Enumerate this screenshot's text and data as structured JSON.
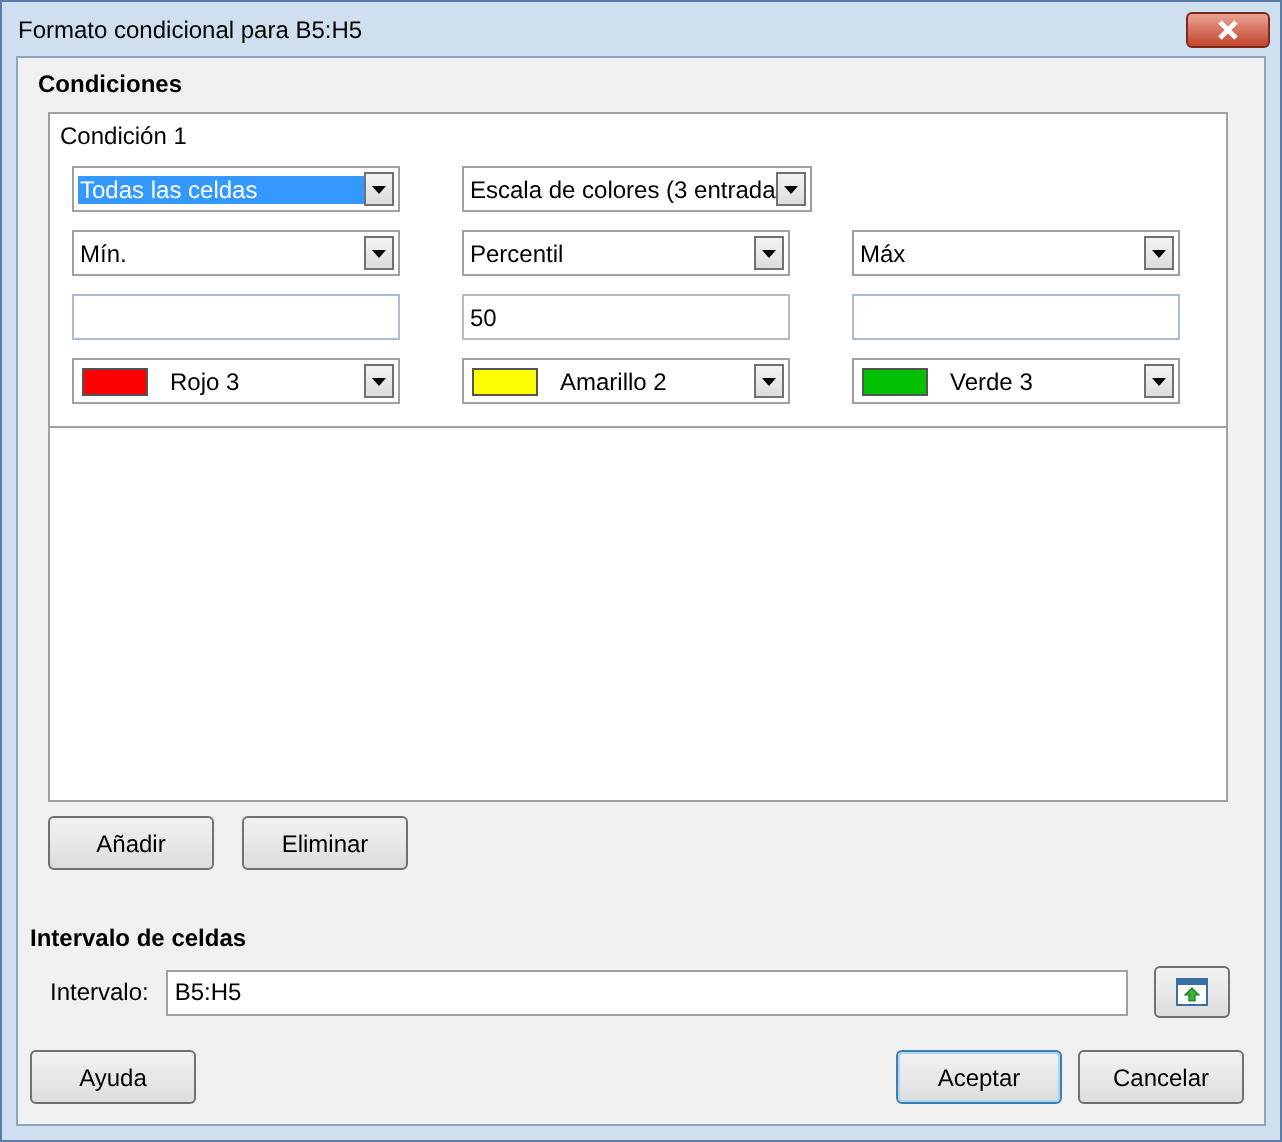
{
  "window": {
    "title": "Formato condicional para B5:H5"
  },
  "conditions": {
    "heading": "Condiciones",
    "items": [
      {
        "title": "Condición 1",
        "rows": [
          [
            {
              "kind": "dropdown",
              "value": "Todas las celdas",
              "focused": true
            },
            {
              "kind": "dropdown",
              "value": "Escala de colores (3 entrada",
              "focused": false
            }
          ],
          [
            {
              "kind": "dropdown",
              "value": "Mín.",
              "focused": false
            },
            {
              "kind": "dropdown",
              "value": "Percentil",
              "focused": false
            },
            {
              "kind": "dropdown",
              "value": "Máx",
              "focused": false
            }
          ],
          [
            {
              "kind": "input"
            },
            {
              "kind": "input",
              "value": "50"
            },
            {
              "kind": "input"
            }
          ],
          [
            {
              "kind": "color",
              "value": "Rojo 3",
              "color": "#ff0000"
            },
            {
              "kind": "color",
              "value": "Amarillo 2",
              "color": "#ffff00"
            },
            {
              "kind": "color",
              "value": "Verde 3",
              "color": "#00c000"
            }
          ]
        ]
      }
    ]
  },
  "condition_buttons": [
    {
      "label": "Añadir"
    },
    {
      "label": "Eliminar"
    }
  ],
  "range": {
    "heading": "Intervalo de celdas",
    "label": "Intervalo:",
    "value": "B5:H5"
  },
  "help_button": {
    "label": "Ayuda"
  },
  "dialog_buttons": [
    {
      "label": "Aceptar",
      "default": true
    },
    {
      "label": "Cancelar",
      "default": false
    }
  ]
}
